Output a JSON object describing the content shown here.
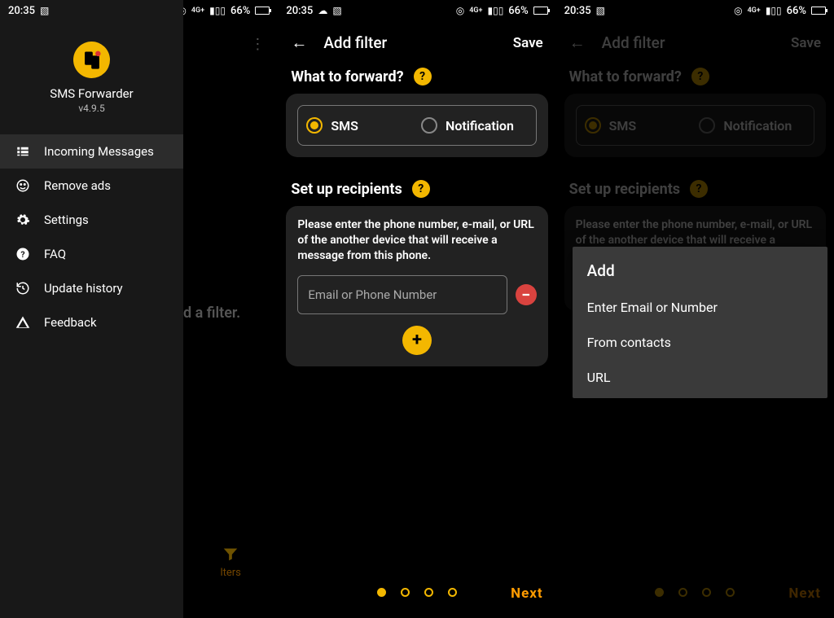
{
  "status_bar": {
    "time": "20:35",
    "battery_pct": "66%",
    "network_label": "4G+"
  },
  "drawer": {
    "app_name": "SMS Forwarder",
    "app_version": "v4.9.5",
    "items": [
      {
        "label": "Incoming Messages"
      },
      {
        "label": "Remove ads"
      },
      {
        "label": "Settings"
      },
      {
        "label": "FAQ"
      },
      {
        "label": "Update history"
      },
      {
        "label": "Feedback"
      }
    ]
  },
  "behind_drawer": {
    "partial_text": "d a filter.",
    "fab_label_partial": "lters"
  },
  "add_filter_screen": {
    "title": "Add filter",
    "save_label": "Save",
    "what_to_forward": {
      "heading": "What to forward?",
      "sms_label": "SMS",
      "notification_label": "Notification"
    },
    "recipients": {
      "heading": "Set up recipients",
      "description": "Please enter the phone number, e-mail, or URL of the another device that will receive a message from this phone.",
      "input_placeholder": "Email or Phone Number"
    },
    "next_label": "Next"
  },
  "popup": {
    "title": "Add",
    "items": [
      "Enter Email or Number",
      "From contacts",
      "URL"
    ]
  }
}
